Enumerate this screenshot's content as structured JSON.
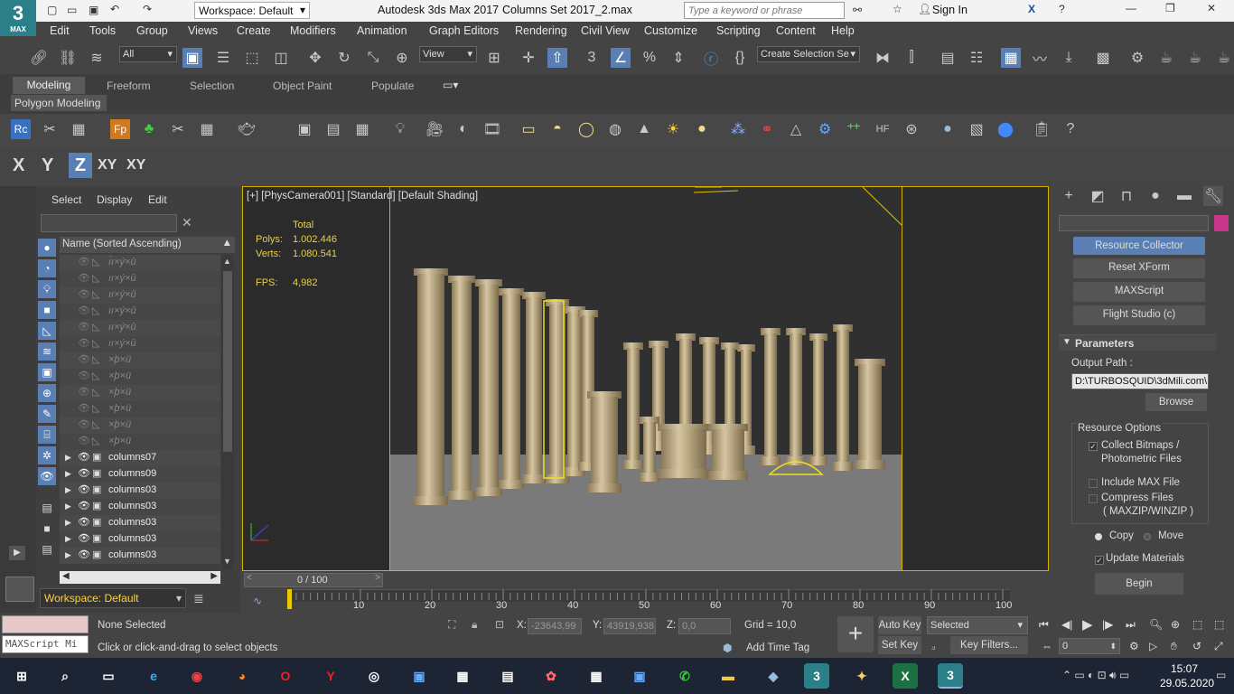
{
  "titlebar": {
    "workspace_label": "Workspace: Default",
    "app_title": "Autodesk 3ds Max 2017",
    "file_title": "Columns Set 2017_2.max",
    "search_placeholder": "Type a keyword or phrase",
    "sign_in": "Sign In"
  },
  "menu": [
    "Edit",
    "Tools",
    "Group",
    "Views",
    "Create",
    "Modifiers",
    "Animation",
    "Graph Editors",
    "Rendering",
    "Civil View",
    "Customize",
    "Scripting",
    "Content",
    "Help"
  ],
  "toolbar": {
    "filter_value": "All",
    "refcoord_value": "View",
    "selection_set_value": "Create Selection Se"
  },
  "ribbon": {
    "tabs": [
      "Modeling",
      "Freeform",
      "Selection",
      "Object Paint",
      "Populate"
    ],
    "sub_label": "Polygon Modeling"
  },
  "axis_buttons": [
    "X",
    "Y",
    "Z",
    "XY",
    "XY"
  ],
  "scene_explorer": {
    "tabs": [
      "Select",
      "Display",
      "Edit"
    ],
    "column_header": "Name (Sorted Ascending)",
    "items": [
      {
        "name": "ı̈ı×ý×û",
        "dim": true
      },
      {
        "name": "ıı×ý×û",
        "dim": true
      },
      {
        "name": "ıı×ý×û",
        "dim": true
      },
      {
        "name": "ıı×ý×û",
        "dim": true
      },
      {
        "name": "ıı×ý×û",
        "dim": true
      },
      {
        "name": "ıı×ý×û",
        "dim": true
      },
      {
        "name": "×þ×ü",
        "dim": true
      },
      {
        "name": "×þ×ü",
        "dim": true
      },
      {
        "name": "×þ×ü",
        "dim": true
      },
      {
        "name": "×þ×ü",
        "dim": true
      },
      {
        "name": "×þ×ü",
        "dim": true
      },
      {
        "name": "×þ×ü",
        "dim": true
      },
      {
        "name": "columns07",
        "dim": false
      },
      {
        "name": "columns09",
        "dim": false
      },
      {
        "name": "columns03",
        "dim": false
      },
      {
        "name": "columns03",
        "dim": false
      },
      {
        "name": "columns03",
        "dim": false
      },
      {
        "name": "columns03",
        "dim": false
      },
      {
        "name": "columns03",
        "dim": false
      }
    ],
    "workspace_value": "Workspace: Default"
  },
  "viewport": {
    "label": "[+] [PhysCamera001] [Standard] [Default Shading]",
    "stats_header": "Total",
    "polys_label": "Polys:",
    "polys_value": "1.002.446",
    "verts_label": "Verts:",
    "verts_value": "1.080.541",
    "fps_label": "FPS:",
    "fps_value": "4,982"
  },
  "command_panel": {
    "buttons": [
      "Resource Collector",
      "Reset XForm",
      "MAXScript",
      "Flight Studio (c)"
    ],
    "parameters_title": "Parameters",
    "output_path_label": "Output Path :",
    "output_path_value": "D:\\TURBOSQUID\\3dMili.com\\",
    "browse": "Browse",
    "resource_options_title": "Resource Options",
    "collect_bitmaps_1": "Collect Bitmaps /",
    "collect_bitmaps_2": "Photometric Files",
    "include_max": "Include MAX File",
    "compress_files": "Compress Files",
    "compress_sub": "( MAXZIP/WINZIP )",
    "copy": "Copy",
    "move": "Move",
    "update_materials": "Update Materials",
    "begin": "Begin",
    "collect_checked": true,
    "update_checked": true
  },
  "timeline": {
    "frame_label": "0 / 100",
    "ticks": [
      "10",
      "20",
      "30",
      "40",
      "50",
      "60",
      "70",
      "80",
      "90",
      "100"
    ]
  },
  "status": {
    "selection": "None Selected",
    "prompt": "Click or click-and-drag to select objects",
    "maxscript": "MAXScript Mi",
    "x_label": "X:",
    "x_value": "-23643,99",
    "y_label": "Y:",
    "y_value": "43919,938",
    "z_label": "Z:",
    "z_value": "0,0",
    "grid": "Grid = 10,0",
    "add_time_tag": "Add Time Tag",
    "auto_key": "Auto Key",
    "set_key": "Set Key",
    "selected_value": "Selected",
    "key_filters": "Key Filters...",
    "frame_value": "0"
  },
  "taskbar": {
    "time": "15:07",
    "date": "29.05.2020"
  }
}
